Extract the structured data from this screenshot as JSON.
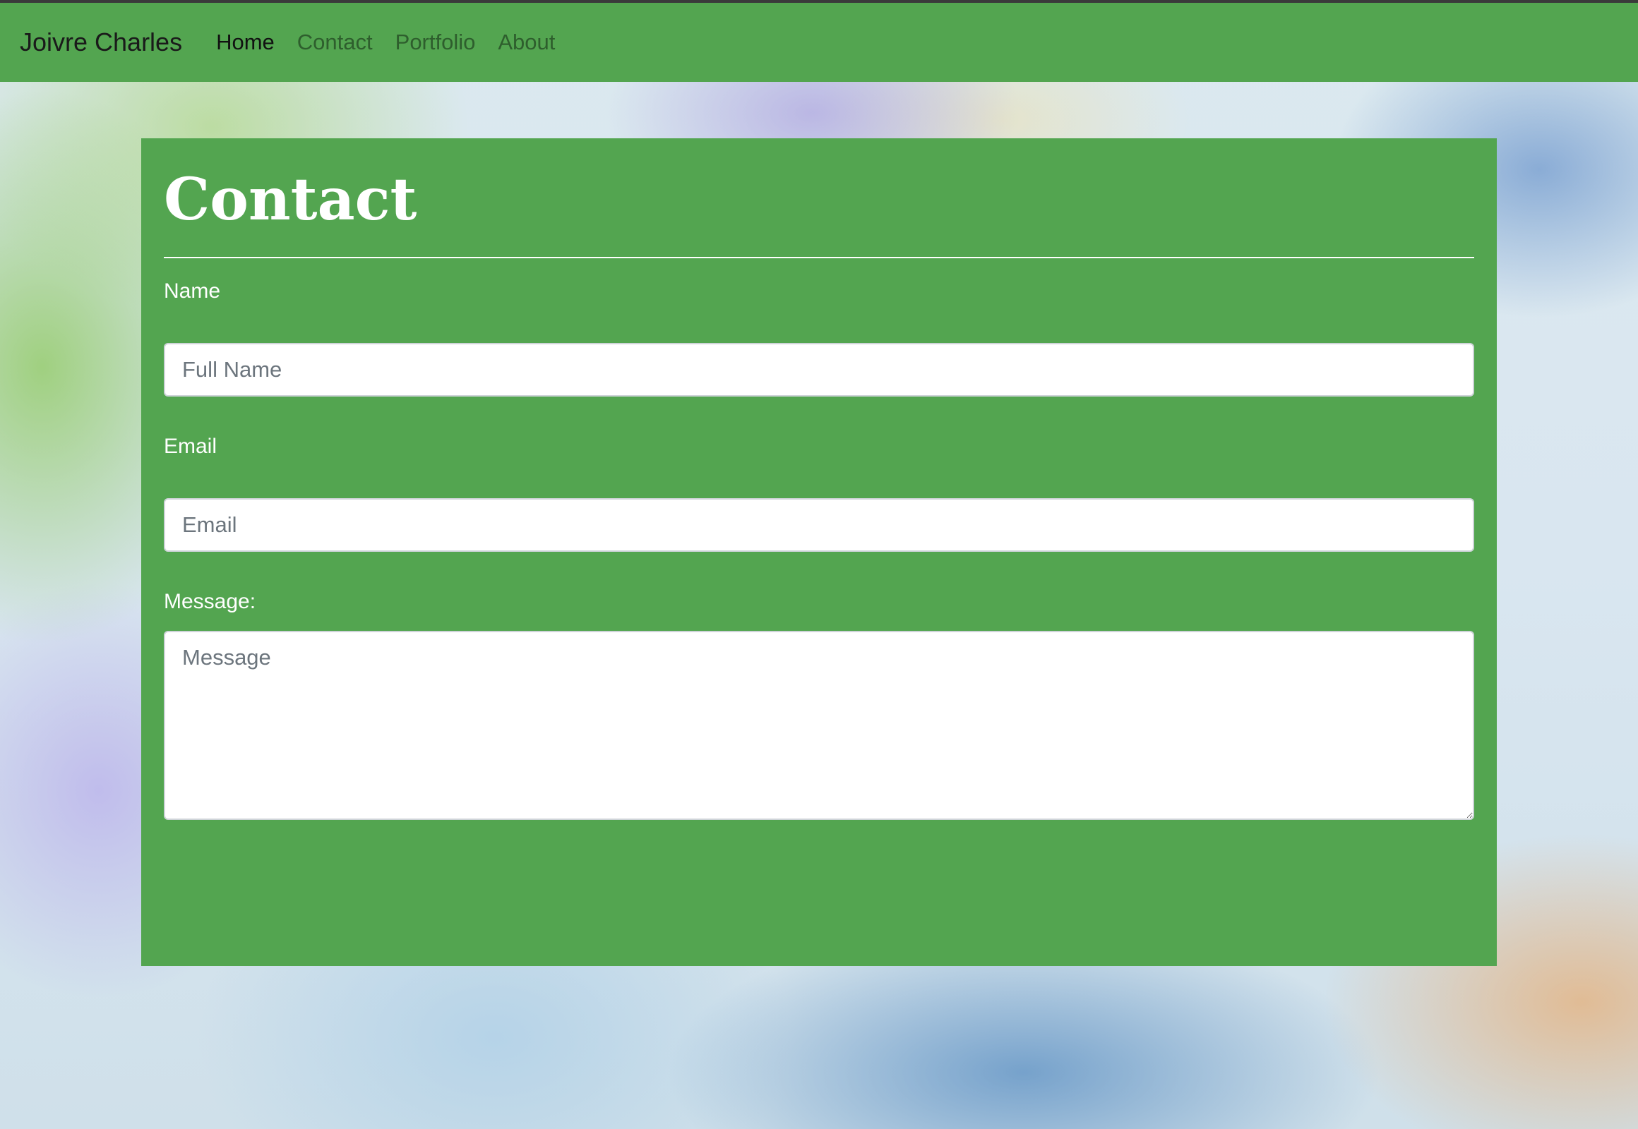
{
  "navbar": {
    "brand": "Joivre Charles",
    "links": [
      {
        "label": "Home",
        "active": true
      },
      {
        "label": "Contact",
        "active": false
      },
      {
        "label": "Portfolio",
        "active": false
      },
      {
        "label": "About",
        "active": false
      }
    ],
    "background_color": "#53a550"
  },
  "contact_form": {
    "title": "Contact",
    "name": {
      "label": "Name",
      "placeholder": "Full Name",
      "value": ""
    },
    "email": {
      "label": "Email",
      "placeholder": "Email",
      "value": ""
    },
    "message": {
      "label": "Message:",
      "placeholder": "Message",
      "value": ""
    },
    "card_color": "#53a550"
  }
}
